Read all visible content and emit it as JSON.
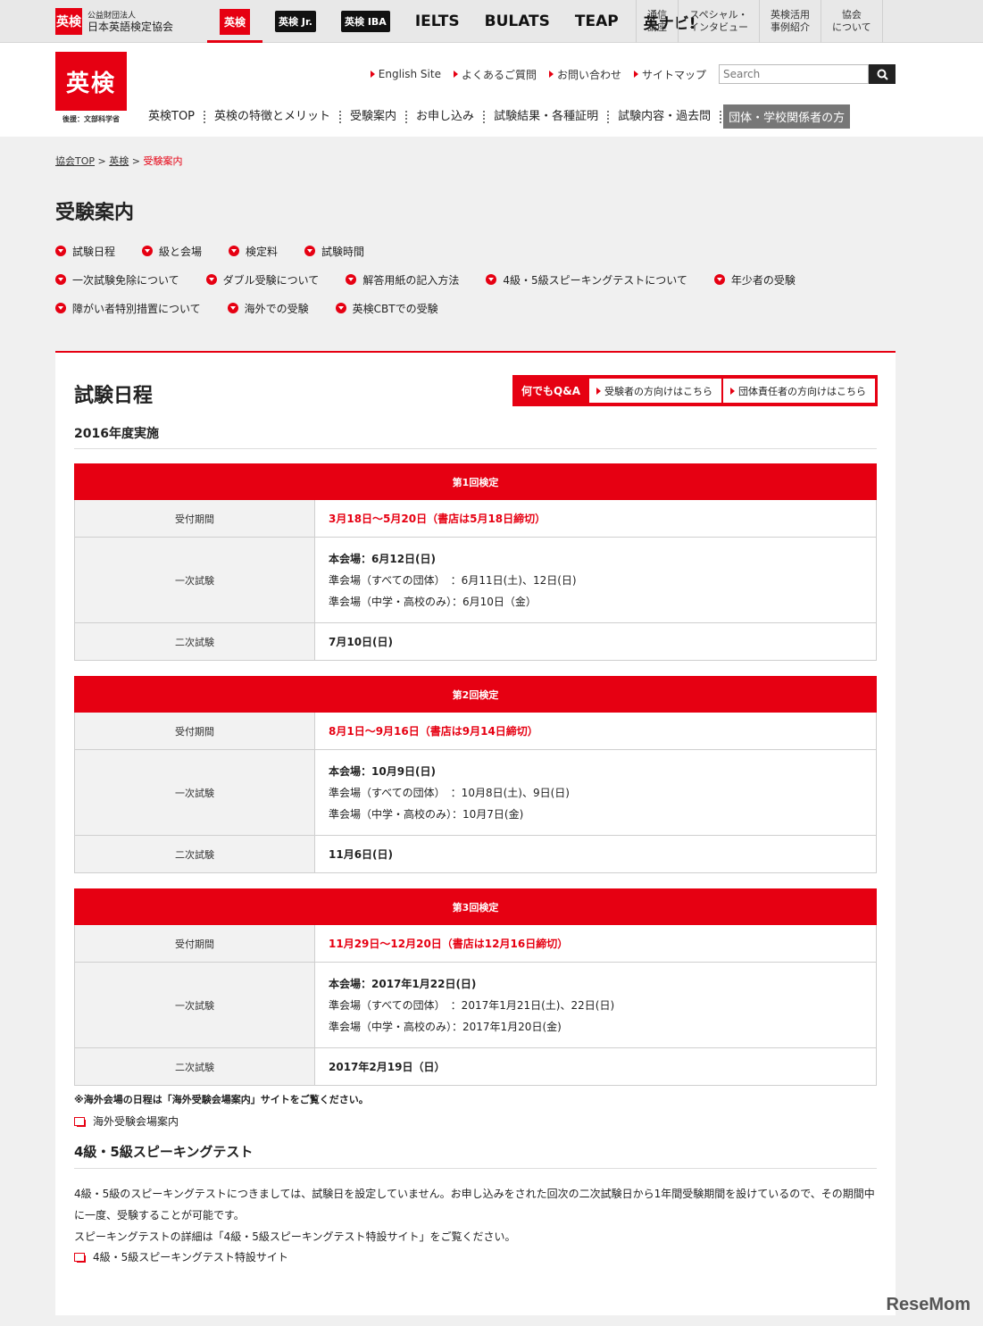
{
  "brandbar": {
    "org_mark": "英検",
    "org_line1": "公益財団法人",
    "org_line2": "日本英語検定協会",
    "brands": [
      {
        "label": "英検",
        "kind": "red",
        "active": true
      },
      {
        "label": "英検 Jr.",
        "kind": "black"
      },
      {
        "label": "英検 IBA",
        "kind": "black"
      },
      {
        "label": "IELTS",
        "kind": "text"
      },
      {
        "label": "BULATS",
        "kind": "text"
      },
      {
        "label": "TEAP",
        "kind": "text"
      },
      {
        "label": "英ナビ!",
        "kind": "text"
      }
    ],
    "links": [
      "通信\n講座",
      "スペシャル・\nインタビュー",
      "英検活用\n事例紹介",
      "協会\nについて"
    ]
  },
  "header": {
    "logo": "英検",
    "logo_sub": "後援：文部科学省",
    "util_links": [
      "English Site",
      "よくあるご質問",
      "お問い合わせ",
      "サイトマップ"
    ],
    "search_placeholder": "Search",
    "gnav": [
      "英検TOP",
      "英検の特徴とメリット",
      "受験案内",
      "お申し込み",
      "試験結果・各種証明",
      "試験内容・過去問"
    ],
    "gnav_group": "団体・学校関係者の方"
  },
  "breadcrumb": {
    "items": [
      "協会TOP",
      "英検"
    ],
    "sep": ">",
    "current": "受験案内"
  },
  "page_title": "受験案内",
  "anchors": [
    [
      "試験日程",
      "級と会場",
      "検定料",
      "試験時間"
    ],
    [
      "一次試験免除について",
      "ダブル受験について",
      "解答用紙の記入方法",
      "4級・5級スピーキングテストについて",
      "年少者の受験"
    ],
    [
      "障がい者特別措置について",
      "海外での受験",
      "英検CBTでの受験"
    ]
  ],
  "section": {
    "title": "試験日程",
    "qa_label": "何でもQ&A",
    "qa_buttons": [
      "受験者の方向けはこちら",
      "団体責任者の方向けはこちら"
    ],
    "year": "2016年度実施"
  },
  "schedules": [
    {
      "head": "第1回検定",
      "rows": {
        "k1": "受付期間",
        "v1": "3月18日～5月20日（書店は5月18日締切）",
        "k2": "一次試験",
        "v2a": "本会場：6月12日(日)",
        "v2b": "準会場（すべての団体）　：6月11日(土)、12日(日)",
        "v2c": "準会場（中学・高校のみ）：6月10日（金）",
        "k3": "二次試験",
        "v3": "7月10日(日)"
      }
    },
    {
      "head": "第2回検定",
      "rows": {
        "k1": "受付期間",
        "v1": "8月1日～9月16日（書店は9月14日締切）",
        "k2": "一次試験",
        "v2a": "本会場：10月9日(日)",
        "v2b": "準会場（すべての団体）　：10月8日(土)、9日(日)",
        "v2c": "準会場（中学・高校のみ）：10月7日(金)",
        "k3": "二次試験",
        "v3": "11月6日(日)"
      }
    },
    {
      "head": "第3回検定",
      "rows": {
        "k1": "受付期間",
        "v1": "11月29日～12月20日（書店は12月16日締切）",
        "k2": "一次試験",
        "v2a": "本会場：2017年1月22日(日)",
        "v2b": "準会場（すべての団体）　：2017年1月21日(土)、22日(日)",
        "v2c": "準会場（中学・高校のみ）：2017年1月20日(金)",
        "k3": "二次試験",
        "v3": "2017年2月19日（日）"
      }
    }
  ],
  "overseas_note": "※海外会場の日程は「海外受験会場案内」サイトをご覧ください。",
  "overseas_link": "海外受験会場案内",
  "speaking": {
    "title": "4級・5級スピーキングテスト",
    "p1": "4級・5級のスピーキングテストにつきましては、試験日を設定していません。お申し込みをされた回次の二次試験日から1年間受験期間を設けているので、その期間中に一度、受験することが可能です。",
    "p2": "スピーキングテストの詳細は「4級・5級スピーキングテスト特設サイト」をご覧ください。",
    "link": "4級・5級スピーキングテスト特設サイト"
  },
  "watermark": "ReseMom",
  "colors": {
    "accent": "#e60012",
    "gray_button": "#777777"
  }
}
